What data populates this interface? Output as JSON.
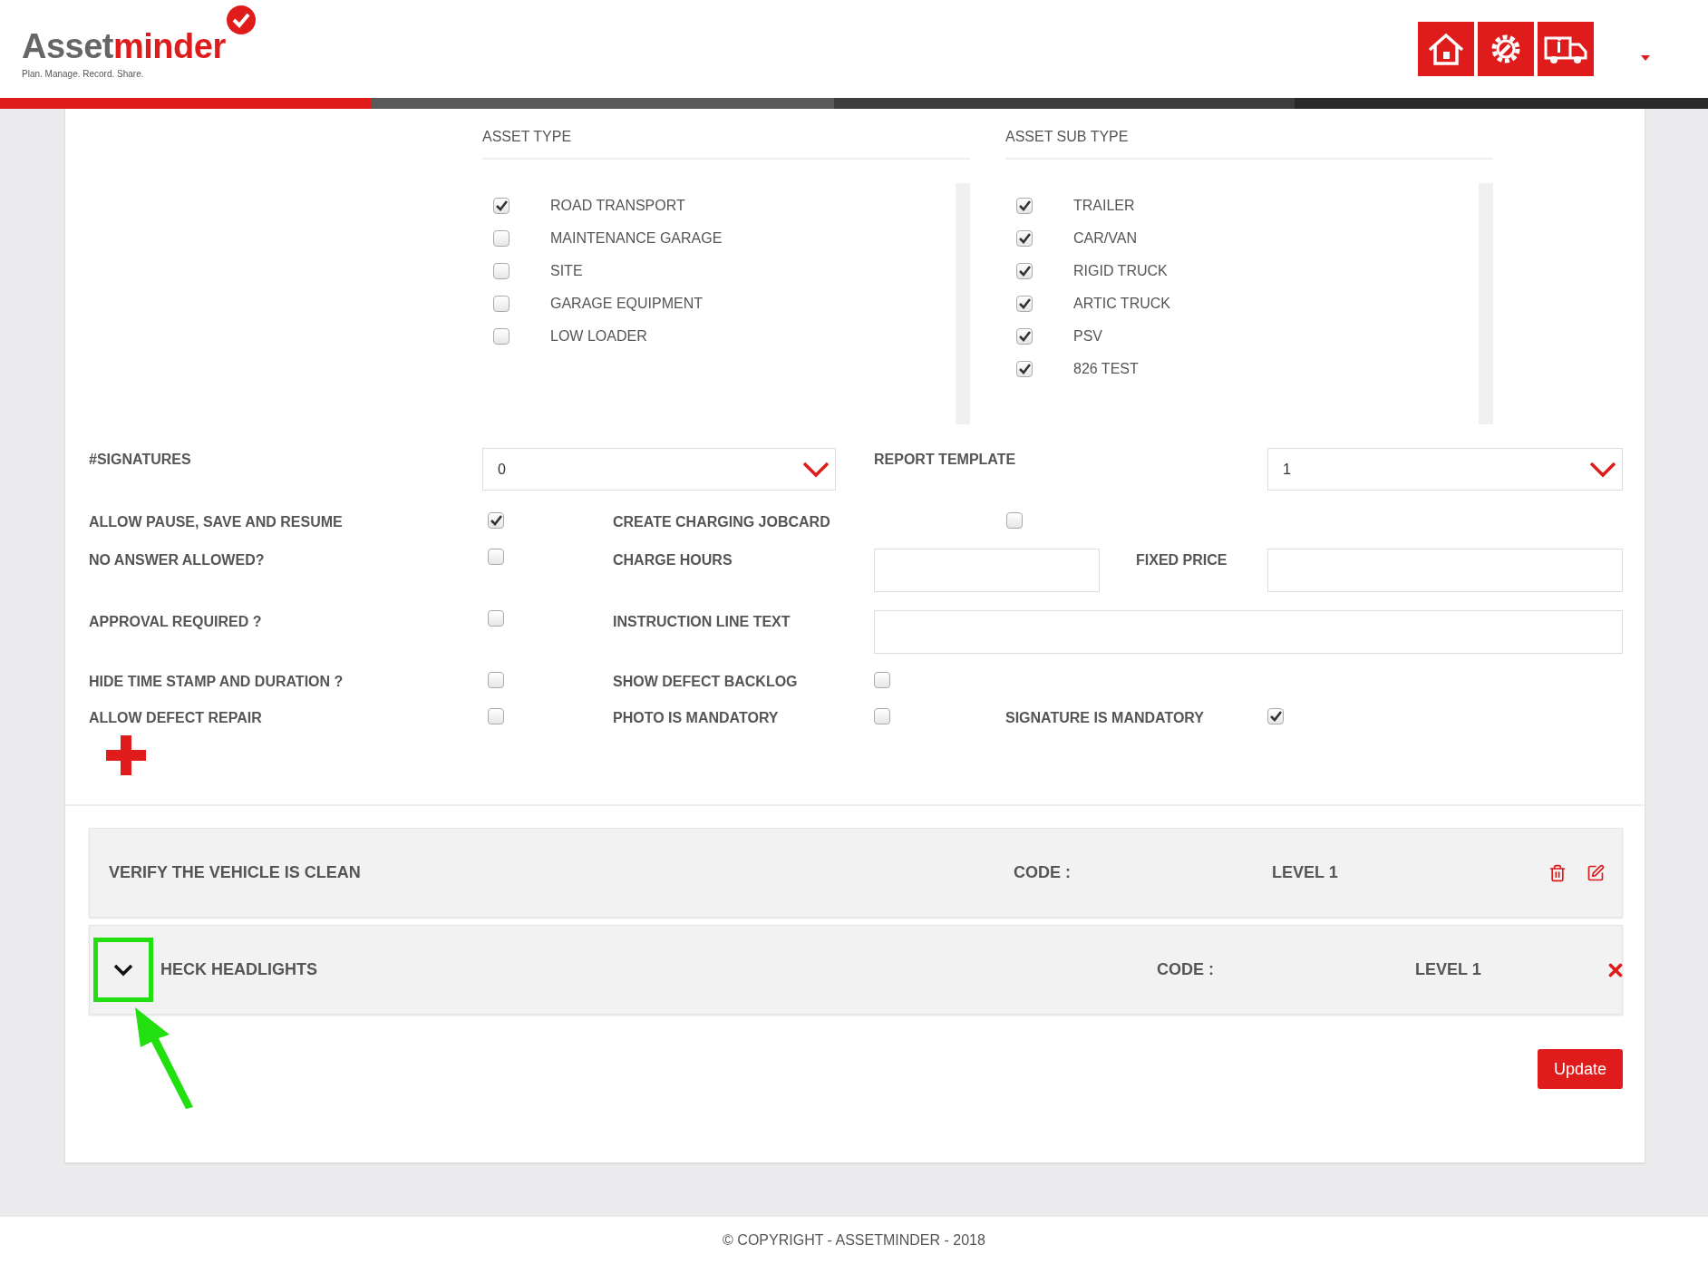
{
  "header": {
    "logo": {
      "part_1": "Asset",
      "part_2": "minder",
      "tagline": "Plan. Manage. Record. Share."
    }
  },
  "asset_type": {
    "title": "ASSET TYPE",
    "items": [
      {
        "label": "ROAD TRANSPORT",
        "checked": true
      },
      {
        "label": "MAINTENANCE GARAGE",
        "checked": false
      },
      {
        "label": "SITE",
        "checked": false
      },
      {
        "label": "GARAGE EQUIPMENT",
        "checked": false
      },
      {
        "label": "LOW LOADER",
        "checked": false
      }
    ]
  },
  "asset_sub_type": {
    "title": "ASSET SUB TYPE",
    "items": [
      {
        "label": "TRAILER",
        "checked": true
      },
      {
        "label": "CAR/VAN",
        "checked": true
      },
      {
        "label": "RIGID TRUCK",
        "checked": true
      },
      {
        "label": "ARTIC TRUCK",
        "checked": true
      },
      {
        "label": "PSV",
        "checked": true
      },
      {
        "label": "826 TEST",
        "checked": true
      }
    ]
  },
  "form_rows": [
    {
      "items": [
        {
          "kind": "label",
          "text": "#SIGNATURES"
        },
        {
          "kind": "select",
          "value": "0"
        },
        {
          "kind": "label",
          "text": "REPORT TEMPLATE"
        },
        {
          "kind": "select",
          "value": "1"
        }
      ]
    },
    {
      "items": [
        {
          "kind": "label",
          "text": "ALLOW PAUSE, SAVE AND RESUME"
        },
        {
          "kind": "checkbox",
          "checked": true
        },
        {
          "kind": "label",
          "text": "CREATE CHARGING JOBCARD"
        },
        {
          "kind": "checkbox",
          "checked": false
        }
      ]
    },
    {
      "items": [
        {
          "kind": "label",
          "text": "NO ANSWER ALLOWED?"
        },
        {
          "kind": "checkbox",
          "checked": false
        },
        {
          "kind": "label",
          "text": "CHARGE HOURS"
        },
        {
          "kind": "input"
        },
        {
          "kind": "label",
          "text": "FIXED PRICE"
        },
        {
          "kind": "input"
        }
      ]
    },
    {
      "items": [
        {
          "kind": "label",
          "text": "APPROVAL REQUIRED ?"
        },
        {
          "kind": "checkbox",
          "checked": false
        },
        {
          "kind": "label",
          "text": "INSTRUCTION LINE TEXT"
        },
        {
          "kind": "input"
        }
      ]
    },
    {
      "items": [
        {
          "kind": "label",
          "text": "HIDE TIME STAMP AND DURATION ?"
        },
        {
          "kind": "checkbox",
          "checked": false
        },
        {
          "kind": "label",
          "text": "SHOW DEFECT BACKLOG"
        },
        {
          "kind": "checkbox",
          "checked": false
        }
      ]
    },
    {
      "items": [
        {
          "kind": "label",
          "text": "ALLOW DEFECT REPAIR"
        },
        {
          "kind": "checkbox",
          "checked": false
        },
        {
          "kind": "label",
          "text": "PHOTO IS MANDATORY"
        },
        {
          "kind": "checkbox",
          "checked": false
        },
        {
          "kind": "label",
          "text": "SIGNATURE IS MANDATORY"
        },
        {
          "kind": "checkbox",
          "checked": true
        }
      ]
    }
  ],
  "questions": [
    {
      "kind": "editable",
      "title": "VERIFY THE VEHICLE IS CLEAN",
      "code": "CODE :",
      "level": "LEVEL 1"
    },
    {
      "kind": "collapsible",
      "title": "HECK HEADLIGHTS",
      "code": "CODE :",
      "level": "LEVEL 1"
    }
  ],
  "update_button": "Update",
  "footer": "© COPYRIGHT - ASSETMINDER - 2018"
}
